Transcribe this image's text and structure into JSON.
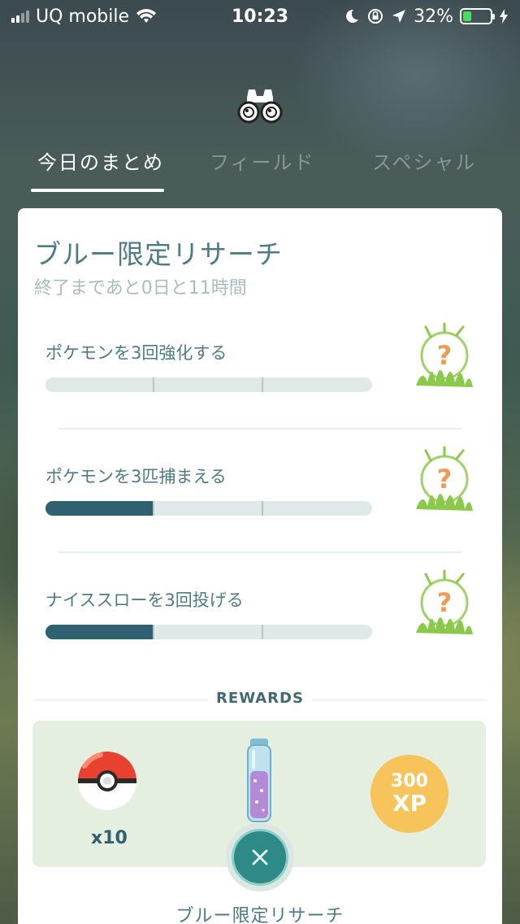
{
  "status_bar": {
    "carrier": "UQ mobile",
    "time": "10:23",
    "battery_percent": "32%",
    "battery_level": 0.32,
    "icons": [
      "signal-icon",
      "wifi-icon",
      "moon-icon",
      "orientation-lock-icon",
      "location-arrow-icon",
      "battery-icon",
      "charging-bolt-icon"
    ]
  },
  "header": {
    "icon": "binoculars-icon",
    "tabs": [
      {
        "label": "今日のまとめ",
        "active": true
      },
      {
        "label": "フィールド",
        "active": false
      },
      {
        "label": "スペシャル",
        "active": false
      }
    ]
  },
  "card": {
    "title": "ブルー限定リサーチ",
    "subtitle": "終了まであと0日と11時間",
    "tasks": [
      {
        "label": "ポケモンを3回強化する",
        "progress": 0,
        "total": 3,
        "reward_icon": "mystery-encounter-icon"
      },
      {
        "label": "ポケモンを3匹捕まえる",
        "progress": 1,
        "total": 3,
        "reward_icon": "mystery-encounter-icon"
      },
      {
        "label": "ナイススローを3回投げる",
        "progress": 1,
        "total": 3,
        "reward_icon": "mystery-encounter-icon"
      }
    ],
    "rewards_heading": "REWARDS",
    "rewards": [
      {
        "icon": "poke-ball-icon",
        "quantity": "x10"
      },
      {
        "icon": "stardust-vial-icon"
      },
      {
        "icon": "xp-badge-icon",
        "amount": "300",
        "unit": "XP"
      }
    ],
    "footer_title": "ブルー限定リサーチ"
  },
  "colors": {
    "progress_fill": "#2f6170",
    "xp_badge": "#f6c45a",
    "close_button": "#2e8a86"
  }
}
